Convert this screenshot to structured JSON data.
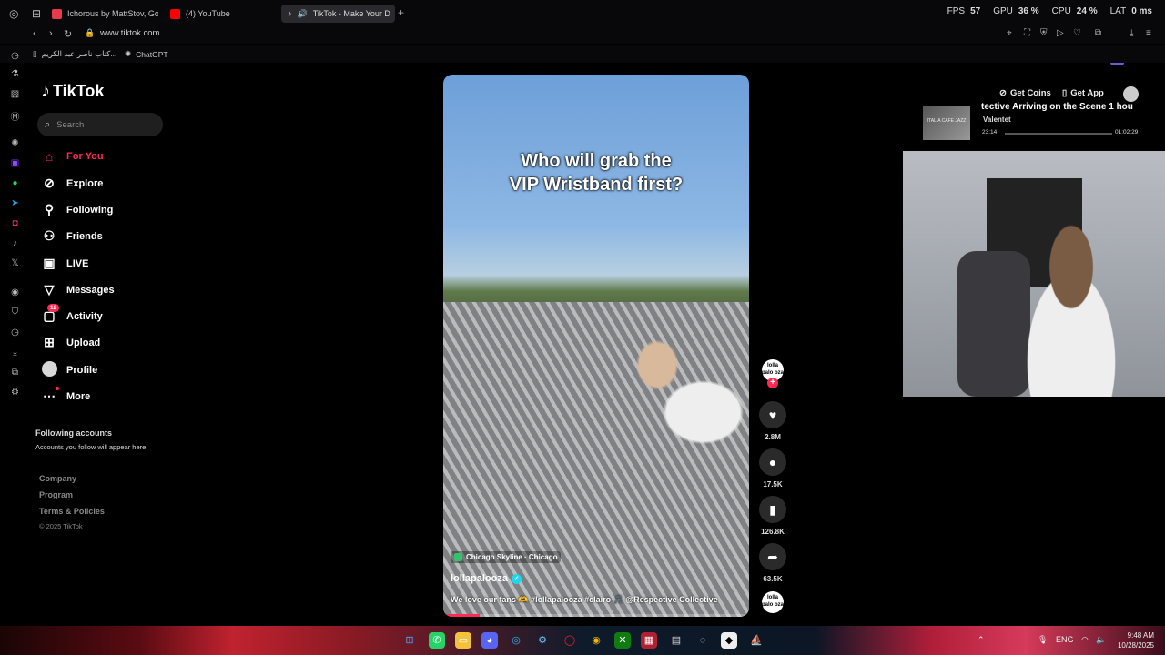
{
  "browser": {
    "tabs": [
      {
        "label": "Ichorous by MattStov, Go",
        "favicon_color": "#e83a4a"
      },
      {
        "label": "(4) YouTube",
        "favicon_color": "#ff0000"
      },
      {
        "label": "TikTok - Make Your D",
        "favicon_color": "#ffffff",
        "active": true
      }
    ],
    "stats": {
      "fps_label": "FPS",
      "fps_value": "57",
      "gpu_label": "GPU",
      "gpu_value": "36 %",
      "cpu_label": "CPU",
      "cpu_value": "24 %",
      "lat_label": "LAT",
      "lat_value": "0 ms"
    },
    "url": "www.tiktok.com",
    "bookmarks": [
      {
        "label": "كتاب ناصر عبد الكريم..."
      },
      {
        "label": "ChatGPT"
      }
    ],
    "profile_initial": "R",
    "rail_label": "GX"
  },
  "tiktok": {
    "logo": "TikTok",
    "search_placeholder": "Search",
    "nav": [
      {
        "label": "For You",
        "icon": "home-icon",
        "active": true
      },
      {
        "label": "Explore",
        "icon": "compass-icon"
      },
      {
        "label": "Following",
        "icon": "following-icon"
      },
      {
        "label": "Friends",
        "icon": "friends-icon"
      },
      {
        "label": "LIVE",
        "icon": "live-icon"
      },
      {
        "label": "Messages",
        "icon": "messages-icon"
      },
      {
        "label": "Activity",
        "icon": "activity-icon",
        "badge": "12"
      },
      {
        "label": "Upload",
        "icon": "upload-icon"
      },
      {
        "label": "Profile",
        "icon": "avatar"
      },
      {
        "label": "More",
        "icon": "more-icon"
      }
    ],
    "following_heading": "Following accounts",
    "following_sub": "Accounts you follow will appear here",
    "footer": [
      "Company",
      "Program",
      "Terms & Policies"
    ],
    "copyright": "© 2025 TikTok",
    "top_actions": {
      "coins": "Get Coins",
      "app": "Get App"
    },
    "video": {
      "overlay_line1": "Who will grab the",
      "overlay_line2": "VIP Wristband first?",
      "location": "Chicago Skyline · Chicago",
      "author": "lollapalooza",
      "description": "We love our fans 🫶 #lollapalooza #clairo 🎵 @Respective Collective",
      "progress": 0.12
    },
    "actions": {
      "creator_avatar": "lolla palo oza",
      "likes": "2.8M",
      "comments": "17.5K",
      "saves": "126.8K",
      "shares": "63.5K"
    }
  },
  "media_overlay": {
    "title": "tective Arriving on the Scene 1 hou",
    "artist": "Valentet",
    "elapsed": "23:14",
    "duration": "01:02:29",
    "thumb_text": "ITALIA CAFE JAZZ"
  },
  "taskbar": {
    "language": "ENG",
    "time": "9:48 AM",
    "date": "10/28/2025"
  }
}
